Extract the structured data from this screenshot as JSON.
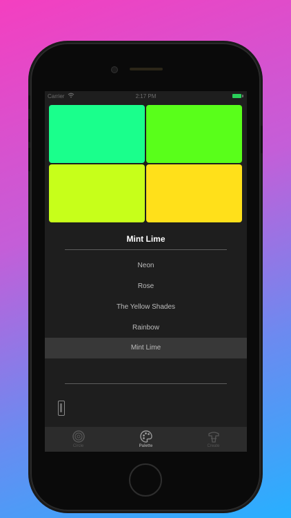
{
  "status_bar": {
    "carrier": "Carrier",
    "time": "2:17 PM"
  },
  "swatches": [
    {
      "name": "mint",
      "color": "#1aff8c"
    },
    {
      "name": "green",
      "color": "#59ff1a"
    },
    {
      "name": "lime",
      "color": "#c7ff1a"
    },
    {
      "name": "yellow",
      "color": "#ffe01a"
    }
  ],
  "palette": {
    "title": "Mint Lime",
    "options": [
      "Neon",
      "Rose",
      "The Yellow Shades",
      "Rainbow",
      "Mint Lime"
    ],
    "selected": "Mint Lime"
  },
  "tabs": [
    {
      "label": "Circle",
      "icon": "circle-icon"
    },
    {
      "label": "Palette",
      "icon": "palette-icon",
      "active": true
    },
    {
      "label": "Create",
      "icon": "create-icon"
    }
  ],
  "colors": {
    "accent_battery": "#2ad05a",
    "screen_bg": "#1e1e1e",
    "selected_row": "#383838"
  }
}
